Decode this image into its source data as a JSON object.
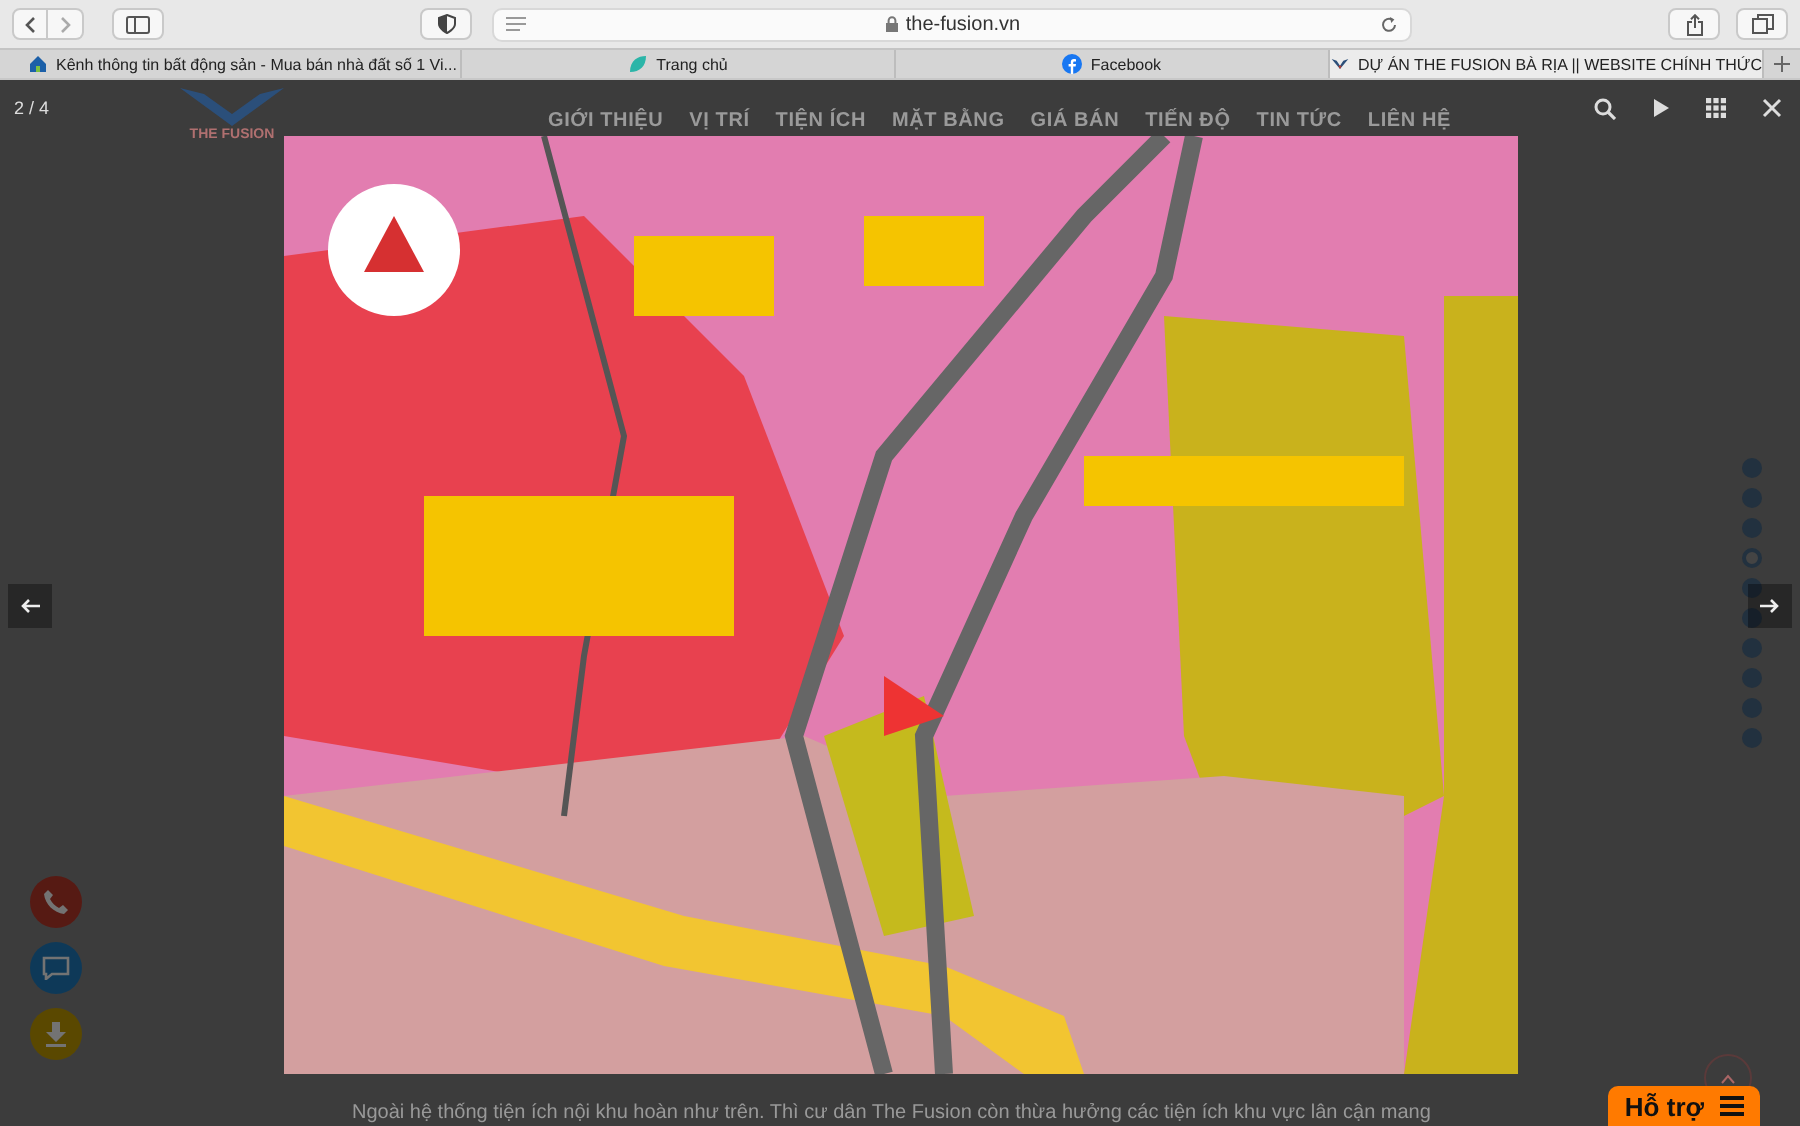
{
  "browser": {
    "address": "the-fusion.vn",
    "tabs": [
      {
        "kind": "house",
        "title": "Kênh thông tin bất động sản - Mua bán nhà đất số 1 Vi...",
        "selected": false
      },
      {
        "kind": "leaf",
        "title": "Trang chủ",
        "selected": false
      },
      {
        "kind": "facebook",
        "title": "Facebook",
        "selected": false
      },
      {
        "kind": "wings",
        "title": "DỰ ÁN THE FUSION BÀ RỊA || WEBSITE CHÍNH THỨC",
        "selected": true
      }
    ]
  },
  "page": {
    "logo": "THE FUSION",
    "nav": [
      "GIỚI THIỆU",
      "VỊ TRÍ",
      "TIỆN ÍCH",
      "MẶT BẰNG",
      "GIÁ BÁN",
      "TIẾN ĐỘ",
      "TIN TỨC",
      "LIÊN HỆ"
    ],
    "paragraph": "Ngoài hệ thống tiện ích nội khu hoàn như trên. Thì cư dân The Fusion còn thừa hưởng các tiện ích khu vực lân cận mang",
    "slide_dots": [
      {
        "selected": false
      },
      {
        "selected": false
      },
      {
        "selected": false
      },
      {
        "selected": true
      },
      {
        "selected": false
      },
      {
        "selected": false
      },
      {
        "selected": false
      },
      {
        "selected": false
      },
      {
        "selected": false
      },
      {
        "selected": false
      }
    ],
    "support_button": "Hỗ trợ"
  },
  "lightbox": {
    "counter": "2 / 4"
  }
}
